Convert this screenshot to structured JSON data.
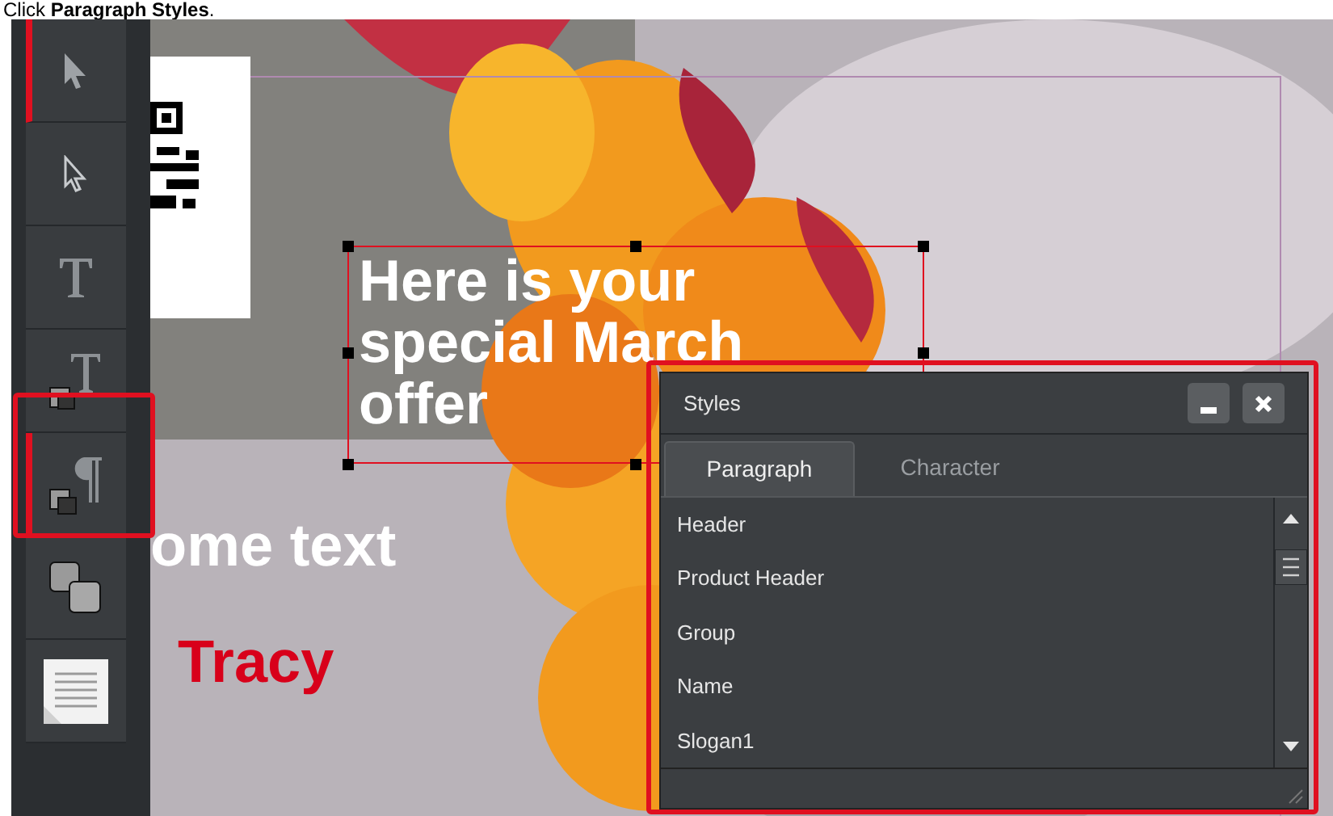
{
  "instruction": "Click **Paragraph Styles**.",
  "toolbar": [
    {
      "kind": "select",
      "selected": true
    },
    {
      "kind": "direct-select",
      "selected": false
    },
    {
      "kind": "text",
      "selected": false
    },
    {
      "kind": "character-style",
      "selected": false
    },
    {
      "kind": "paragraph-style",
      "selected": true
    },
    {
      "kind": "layers",
      "selected": false
    },
    {
      "kind": "page",
      "selected": false
    }
  ],
  "canvas": {
    "headline": [
      "Here is your",
      "special March",
      "offer"
    ],
    "body_text": "ome text",
    "name_text": "Tracy"
  },
  "styles_panel": {
    "title": "Styles",
    "tabs": [
      {
        "label": "Paragraph",
        "selected": true
      },
      {
        "label": "Character",
        "selected": false
      }
    ],
    "items": [
      "Header",
      "Product Header",
      "Group",
      "Name",
      "Slogan1"
    ]
  }
}
